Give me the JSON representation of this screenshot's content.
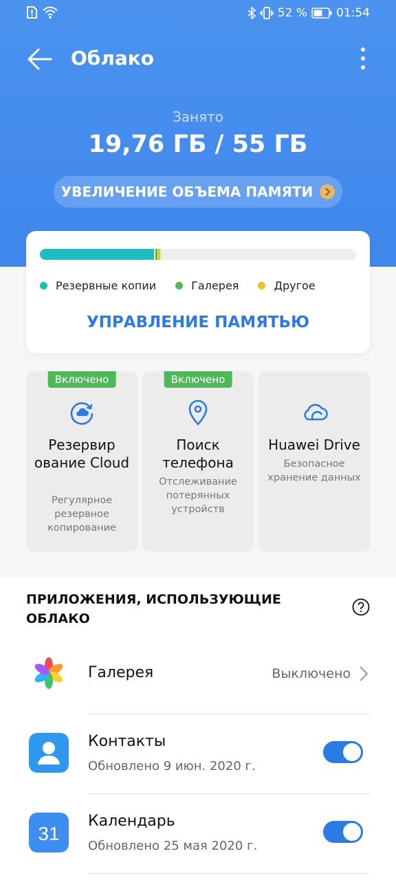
{
  "status_bar": {
    "battery_percent": "52 %",
    "time": "01:54"
  },
  "app_bar": {
    "title": "Облако"
  },
  "storage": {
    "used_label": "Занято",
    "used_value": "19,76 ГБ / 55 ГБ",
    "increase_label": "УВЕЛИЧЕНИЕ ОБЪЕМА ПАМЯТИ",
    "manage_label": "УПРАВЛЕНИЕ ПАМЯТЬЮ",
    "segments": [
      {
        "name": "Резервные копии",
        "color": "#1fbdbf",
        "fraction": 0.36
      },
      {
        "name": "Галерея",
        "color": "#4fb95a",
        "fraction": 0.004
      },
      {
        "name": "Другое",
        "color": "#f2bd2c",
        "fraction": 0.004
      }
    ]
  },
  "features": [
    {
      "badge": "Включено",
      "title": "Резервир ование Cloud",
      "sub": "Регулярное резервное копирование",
      "icon": "cloud-backup-icon"
    },
    {
      "badge": "Включено",
      "title": "Поиск телефона",
      "sub": "Отслеживание потерянных устройств",
      "icon": "location-pin-icon"
    },
    {
      "badge": "",
      "title": "Huawei Drive",
      "sub": "Безопасное хранение данных",
      "icon": "cloud-drive-icon"
    }
  ],
  "apps_section": {
    "title": "ПРИЛОЖЕНИЯ, ИСПОЛЬЗУЮЩИЕ ОБЛАКО",
    "apps": [
      {
        "name": "Галерея",
        "status": "Выключено",
        "icon": "gallery-flower-icon"
      },
      {
        "name": "Контакты",
        "sub": "Обновлено 9 июн. 2020 г.",
        "toggle": true,
        "icon": "contacts-icon"
      },
      {
        "name": "Календарь",
        "sub": "Обновлено 25 мая 2020 г.",
        "toggle": true,
        "icon": "calendar-icon",
        "icon_text": "31"
      }
    ]
  },
  "colors": {
    "primary": "#2a7be3",
    "header": "#4690ee",
    "badge_green": "#4fb95a"
  }
}
